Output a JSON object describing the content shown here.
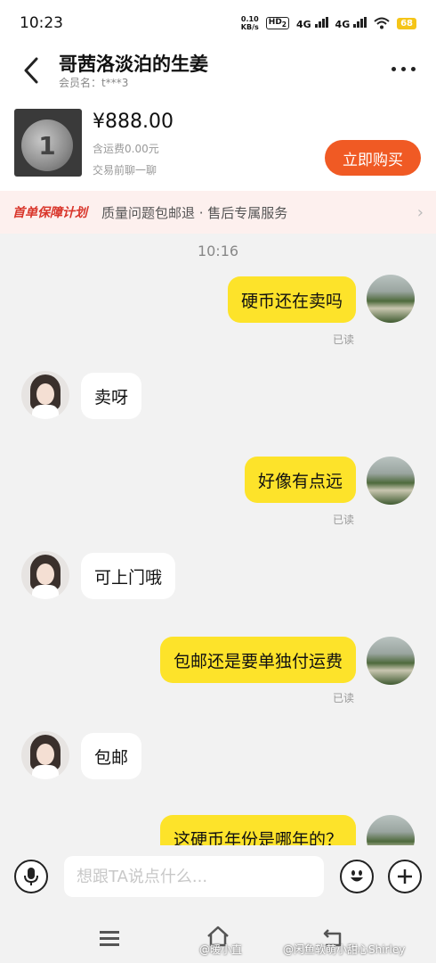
{
  "statusbar": {
    "time": "10:23",
    "net_speed_value": "0.10",
    "net_speed_unit": "KB/s",
    "hd_label": "HD",
    "hd_sub": "2",
    "sig1_label": "4G",
    "sig2_label": "4G",
    "battery": "68"
  },
  "header": {
    "title": "哥茜洛淡泊的生姜",
    "member": "会员名：t***3"
  },
  "product": {
    "price": "¥888.00",
    "shipping": "含运费0.00元",
    "chat_hint": "交易前聊一聊",
    "buy_label": "立即购买"
  },
  "protection": {
    "title": "首单保障计划",
    "text": "质量问题包邮退 · 售后专属服务"
  },
  "chat": {
    "timestamp": "10:16",
    "messages": [
      {
        "from": "me",
        "text": "硬币还在卖吗",
        "read": "已读"
      },
      {
        "from": "peer",
        "text": "卖呀"
      },
      {
        "from": "me",
        "text": "好像有点远",
        "read": "已读"
      },
      {
        "from": "peer",
        "text": "可上门哦"
      },
      {
        "from": "me",
        "text": "包邮还是要单独付运费",
        "read": "已读"
      },
      {
        "from": "peer",
        "text": "包邮"
      },
      {
        "from": "me",
        "text": "这硬币年份是哪年的？"
      }
    ]
  },
  "inputbar": {
    "placeholder": "想跟TA说点什么..."
  },
  "watermark": {
    "left": "@暖小直",
    "right": "@闲鱼软萌小甜心Shirley"
  },
  "colors": {
    "my_bubble": "#fde32a",
    "buy_button": "#f05a24",
    "protection_title": "#d9362b"
  }
}
